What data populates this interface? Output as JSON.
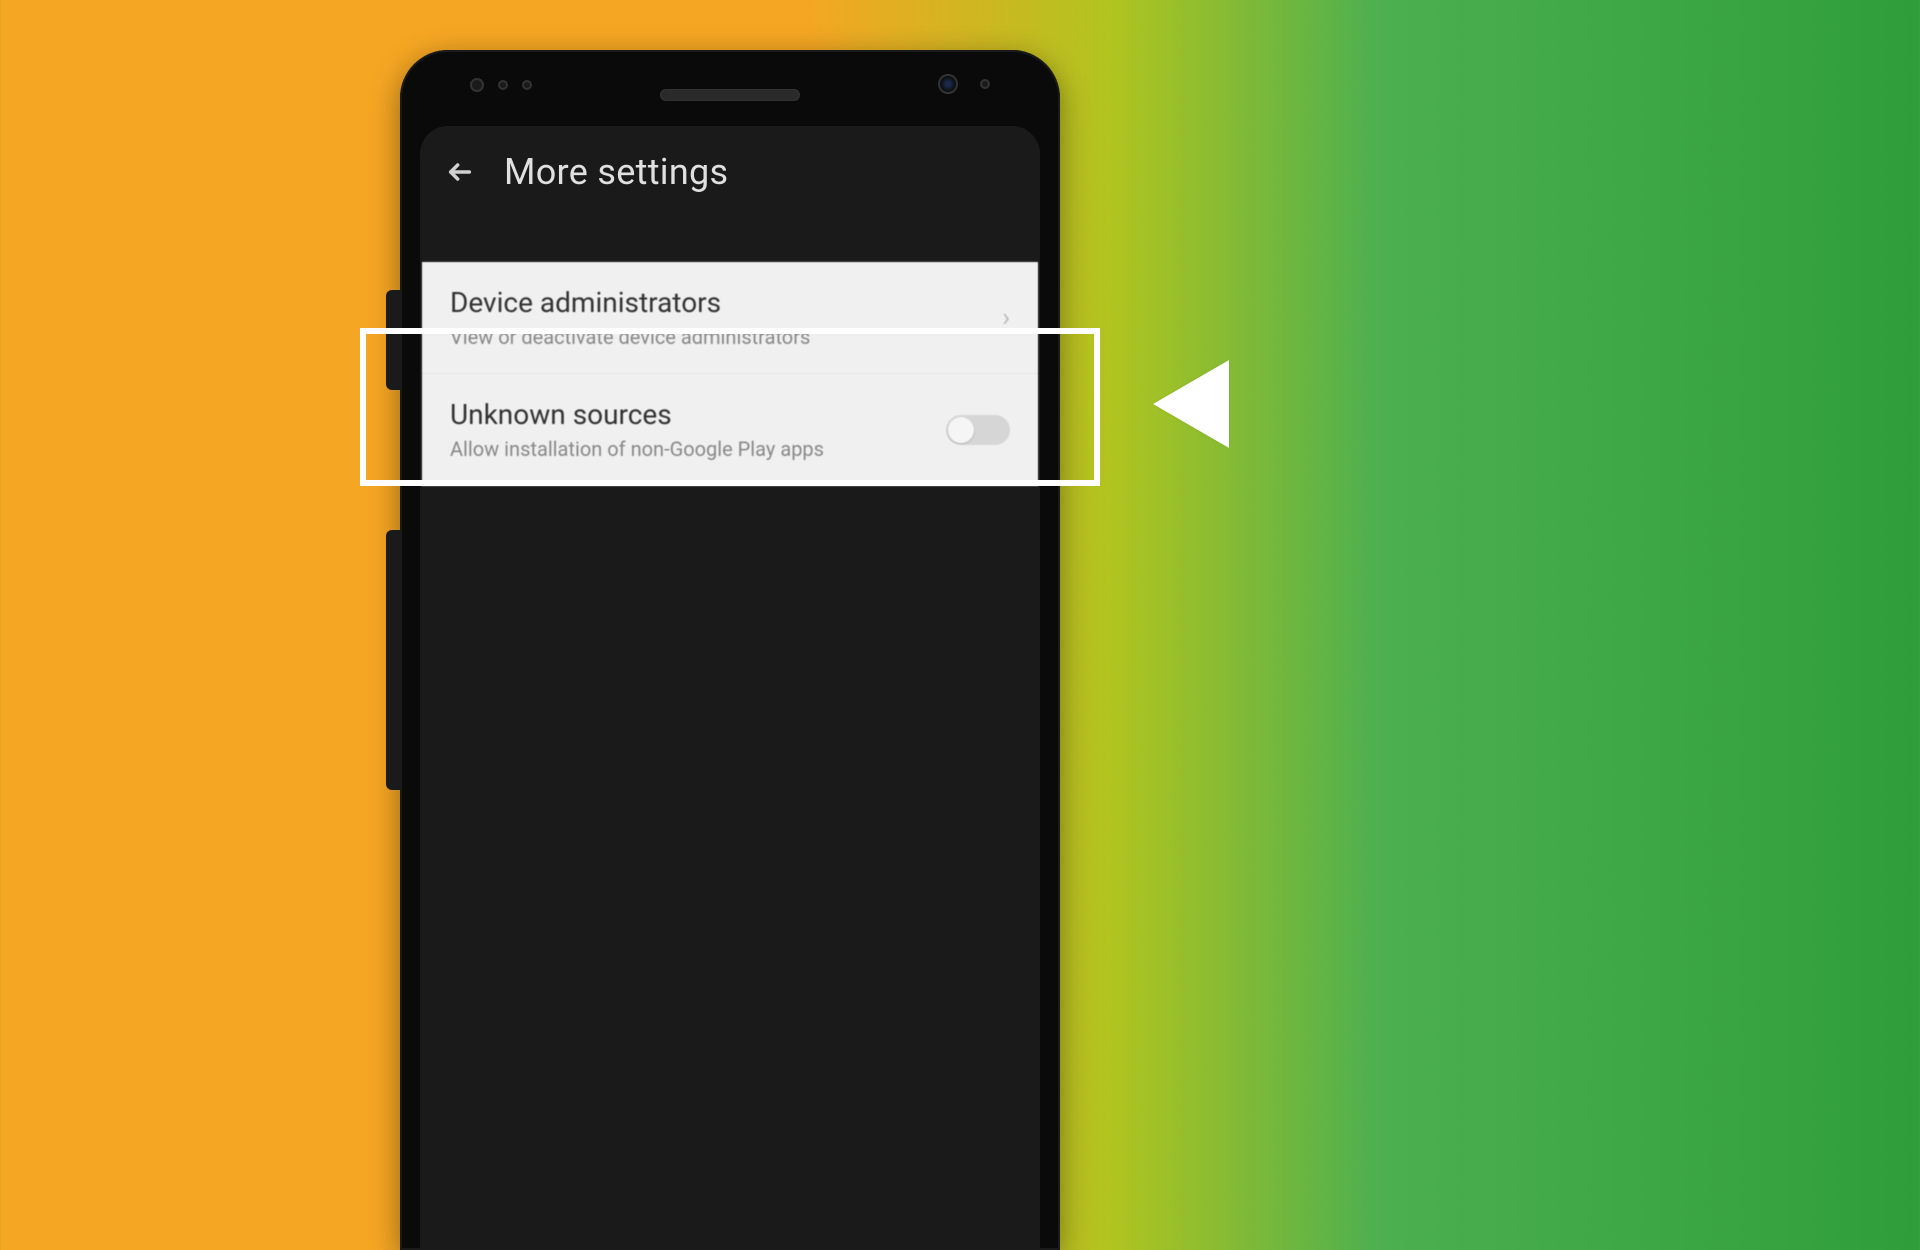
{
  "appbar": {
    "title": "More settings"
  },
  "settings": {
    "row1": {
      "title": "Device administrators",
      "subtitle": "View or deactivate device administrators"
    },
    "row2": {
      "title": "Unknown sources",
      "subtitle": "Allow installation of non-Google Play apps",
      "toggle_on": false
    }
  }
}
